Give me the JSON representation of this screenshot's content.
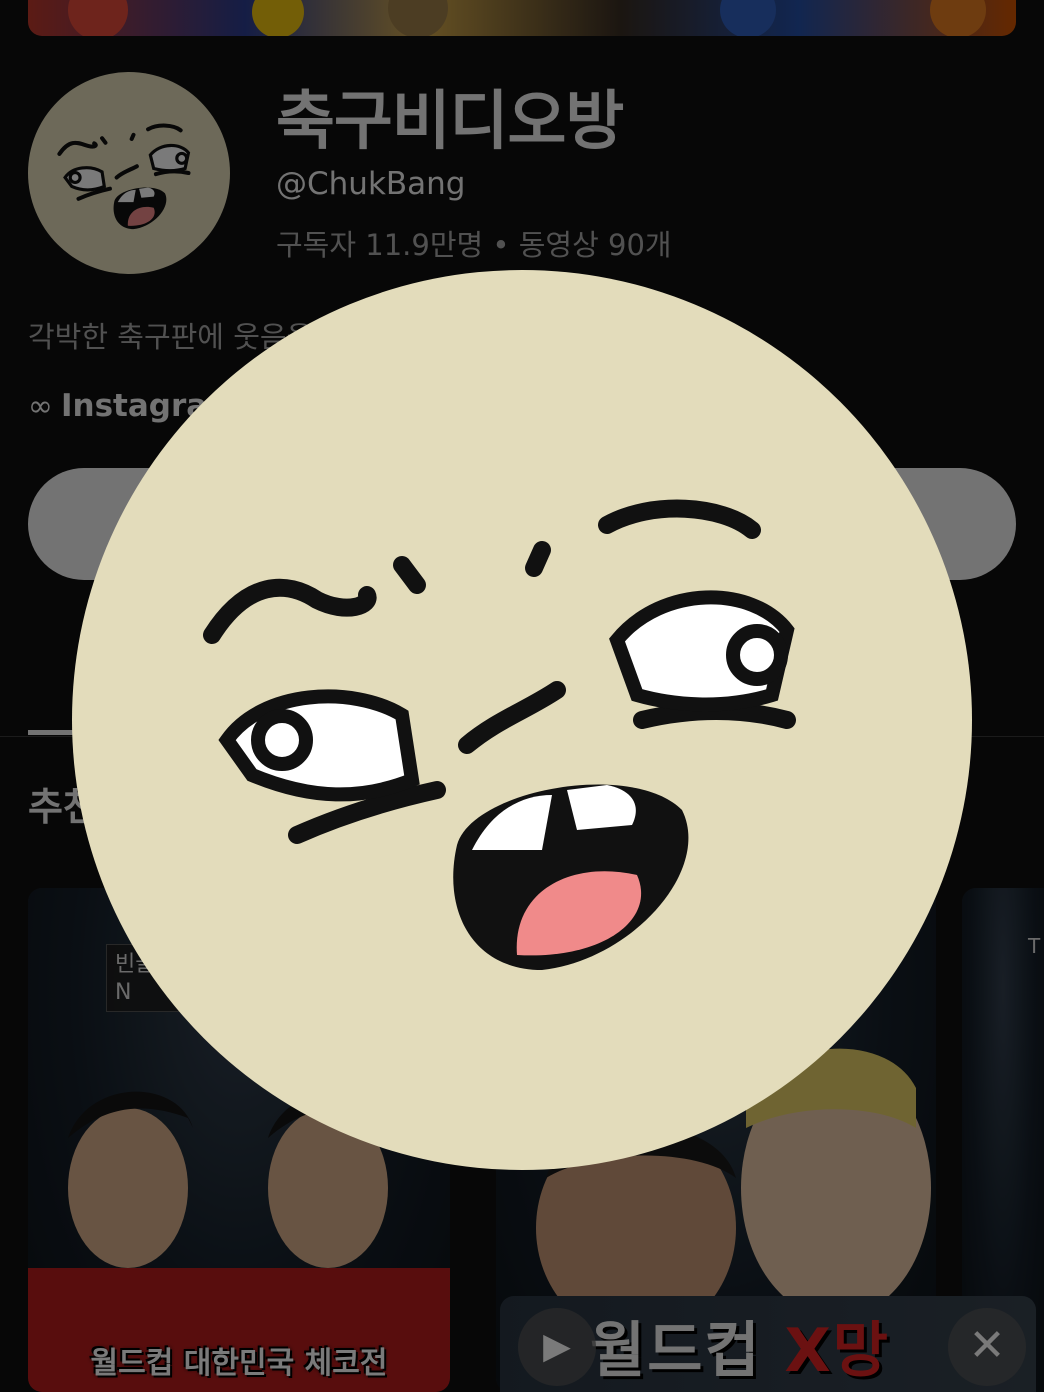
{
  "channel": {
    "name": "축구비디오방",
    "handle": "@ChukBang",
    "stats": "구독자 11.9만명 • 동영상 90개",
    "description": "각박한 축구판에 웃음을",
    "link_icon": "link-icon",
    "link_text": "Instagram"
  },
  "section": {
    "title": "추천"
  },
  "videos": [
    {
      "caption": "월드컵 대한민국 체코전",
      "label_line1": "빈골",
      "label_line2": "N"
    },
    {
      "caption": ""
    },
    {
      "label": "T"
    }
  ],
  "mini_player": {
    "title_part1": "월드컵 ",
    "title_part2": "X망",
    "play_icon": "play-icon",
    "close_icon": "close-icon"
  },
  "colors": {
    "background": "#0f0f0f",
    "avatar_bg": "#e3dcbb",
    "mouth_inner": "#f08a8a",
    "text_primary": "#f1f1f1",
    "text_secondary": "#aaaaaa"
  }
}
